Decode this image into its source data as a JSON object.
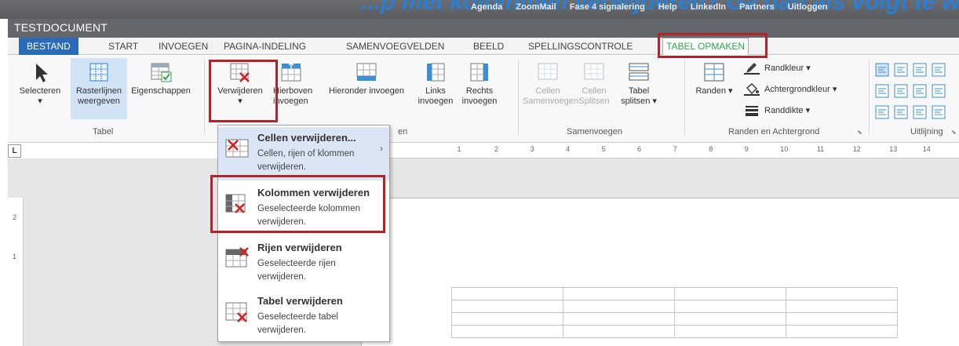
{
  "top_bar": {
    "links": [
      "Agenda",
      "ZoomMail",
      "Fase 4 signalering",
      "Help",
      "LinkedIn",
      "Partners",
      "Uitloggen"
    ],
    "heading_fragment": "...p met kolommen verwijderen? Ga dan als volgt te werk..."
  },
  "window": {
    "title": "TESTDOCUMENT"
  },
  "tabs": [
    {
      "label": "BESTAND"
    },
    {
      "label": "START"
    },
    {
      "label": "INVOEGEN"
    },
    {
      "label": "PAGINA-INDELING"
    },
    {
      "label": "SAMENVOEGVELDEN"
    },
    {
      "label": "BEELD"
    },
    {
      "label": "SPELLINGSCONTROLE"
    },
    {
      "label": "TABEL OPMAKEN"
    }
  ],
  "ribbon": {
    "selecteren": "Selecteren",
    "rasterlijnen_1": "Rasterlijnen",
    "rasterlijnen_2": "weergeven",
    "eigenschappen": "Eigenschappen",
    "tabel_group": "Tabel",
    "verwijderen": "Verwijderen",
    "hierboven_1": "Hierboven",
    "hierboven_2": "invoegen",
    "hieronder": "Hieronder invoegen",
    "links_1": "Links",
    "links_2": "invoegen",
    "rechts_1": "Rechts",
    "rechts_2": "invoegen",
    "rijen_group_tail": "en",
    "cellen_samen_1": "Cellen",
    "cellen_samen_2": "Samenvoegen",
    "cellen_split_1": "Cellen",
    "cellen_split_2": "Splitsen",
    "tabel_split_1": "Tabel",
    "tabel_split_2": "splitsen ▾",
    "samenvoegen_group": "Samenvoegen",
    "randen": "Randen ▾",
    "randkleur": "Randkleur ▾",
    "achtergrondkleur": "Achtergrondkleur ▾",
    "randdikte": "Randdikte ▾",
    "randen_group": "Randen en Achtergrond",
    "uitlijning_group": "Uitlijning"
  },
  "menu": {
    "items": [
      {
        "title": "Cellen verwijderen...",
        "desc": "Cellen, rijen of klommen verwijderen.",
        "icon": "delete-cells-icon"
      },
      {
        "title": "Kolommen verwijderen",
        "desc": "Geselecteerde kolommen verwijderen.",
        "icon": "delete-columns-icon"
      },
      {
        "title": "Rijen verwijderen",
        "desc": "Geselecteerde rijen verwijderen.",
        "icon": "delete-rows-icon"
      },
      {
        "title": "Tabel verwijderen",
        "desc": "Geselecteerde tabel verwijderen.",
        "icon": "delete-table-icon"
      }
    ]
  },
  "ruler": {
    "corner": "L",
    "h_marks": [
      "1",
      "2",
      "3",
      "4",
      "5",
      "6",
      "7",
      "8",
      "9",
      "10",
      "11",
      "12",
      "13",
      "14"
    ],
    "v_marks": [
      "2",
      "1"
    ]
  },
  "colors": {
    "accent_blue": "#2a6ab8",
    "active_tab_green": "#2ea84a",
    "highlight_red": "#b3232a",
    "delete_x_red": "#cc2222"
  }
}
